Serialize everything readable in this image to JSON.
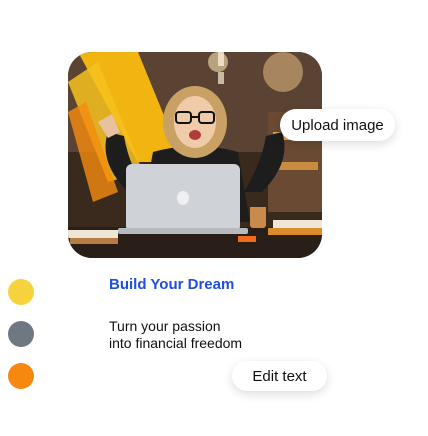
{
  "image": {
    "alt": "Woman with glasses celebrating at laptop",
    "upload_label": "Upload image"
  },
  "content": {
    "title": "Build Your Dream",
    "description_line1": "Turn your passion",
    "description_line2": "into financial freedom",
    "edit_label": "Edit text"
  },
  "colors": {
    "accent_title": "#1e4fe0",
    "swatches": [
      "#f6d33c",
      "#6e7782",
      "#f7880f"
    ]
  }
}
